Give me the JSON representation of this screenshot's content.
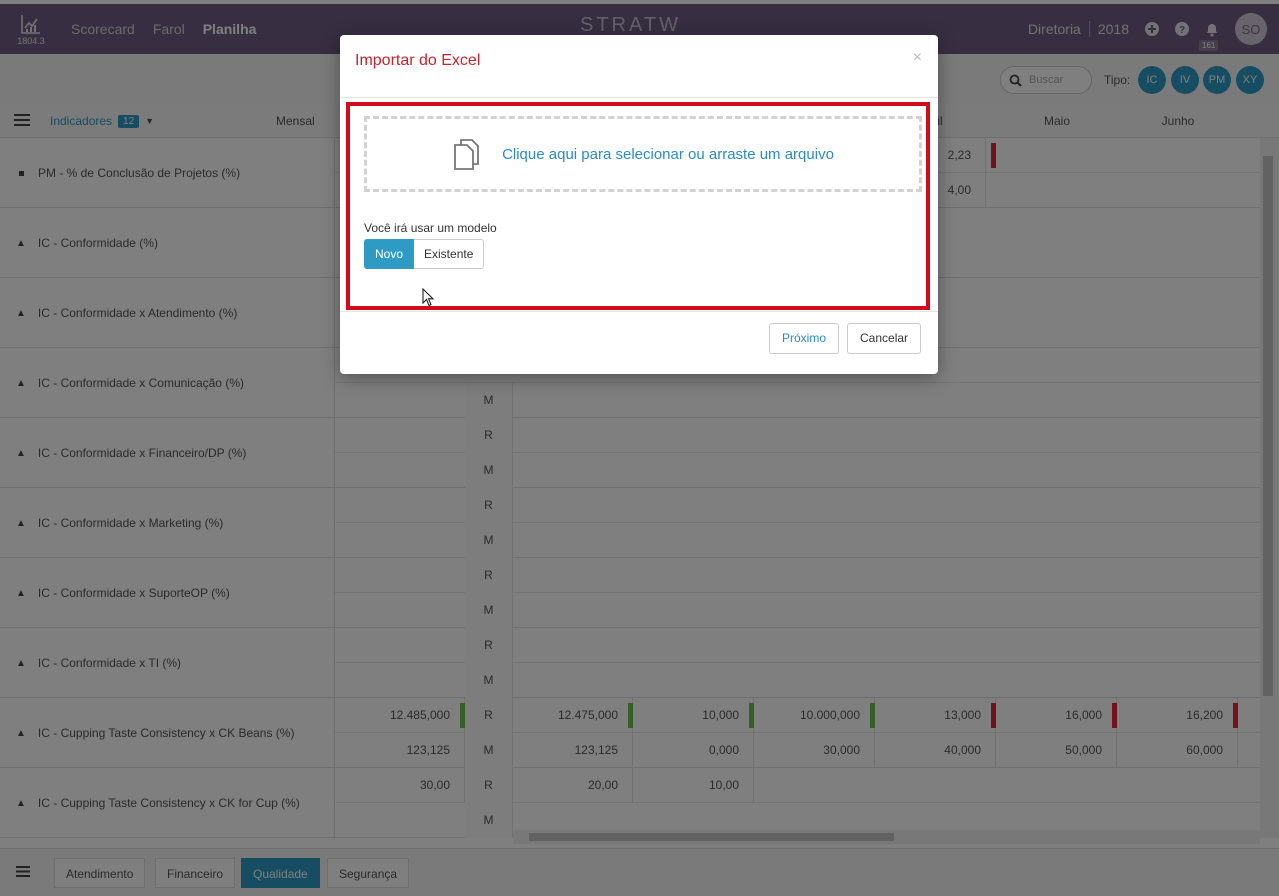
{
  "topbar": {
    "version": "1804.3",
    "nav": [
      "Scorecard",
      "Farol",
      "Planilha"
    ],
    "brand": "STRATW",
    "unit": "Diretoria",
    "year": "2018",
    "notifications": "161",
    "avatar": "SO"
  },
  "toolbar": {
    "search_placeholder": "Buscar",
    "tipo_label": "Tipo:",
    "tipo_buttons": [
      "IC",
      "IV",
      "PM",
      "XY"
    ]
  },
  "grid": {
    "indicators_label": "Indicadores",
    "indicators_count": "12",
    "period_label": "Mensal",
    "months_visible": [
      "il",
      "Maio",
      "Junho"
    ],
    "r_label": "R",
    "m_label": "M",
    "indicators": [
      "PM - % de Conclusão de Projetos (%)",
      "IC - Conformidade (%)",
      "IC - Conformidade x Atendimento (%)",
      "IC - Conformidade x Comunicação (%)",
      "IC - Conformidade x Financeiro/DP (%)",
      "IC - Conformidade x Marketing (%)",
      "IC - Conformidade x SuporteOP (%)",
      "IC - Conformidade x TI (%)",
      "IC - Cupping Taste Consistency x CK Beans (%)",
      "IC - Cupping Taste Consistency x CK for Cup (%)"
    ],
    "row1_values": {
      "r": "2,23",
      "m": "4,00"
    },
    "beans_r": [
      "12.485,000",
      "12.475,000",
      "10,000",
      "10.000,000",
      "13,000",
      "16,000",
      "16,200"
    ],
    "beans_m": [
      "123,125",
      "123,125",
      "0,000",
      "30,000",
      "40,000",
      "50,000",
      "60,000"
    ],
    "cup_r": [
      "30,00",
      "20,00",
      "10,00"
    ]
  },
  "bottom_tabs": [
    "Atendimento",
    "Financeiro",
    "Qualidade",
    "Segurança"
  ],
  "modal": {
    "title": "Importar do Excel",
    "close": "×",
    "dropzone_text": "Clique aqui para selecionar ou arraste um arquivo",
    "model_question": "Você irá usar um modelo",
    "toggle_new": "Novo",
    "toggle_existing": "Existente",
    "next_button": "Próximo",
    "cancel_button": "Cancelar"
  },
  "colors": {
    "topbar": "#6f5f82",
    "accent": "#2d9bc4",
    "modal_title": "#c0262e",
    "highlight": "#d20a1a",
    "flag_green": "#6abf4b",
    "flag_red": "#e0263b"
  }
}
